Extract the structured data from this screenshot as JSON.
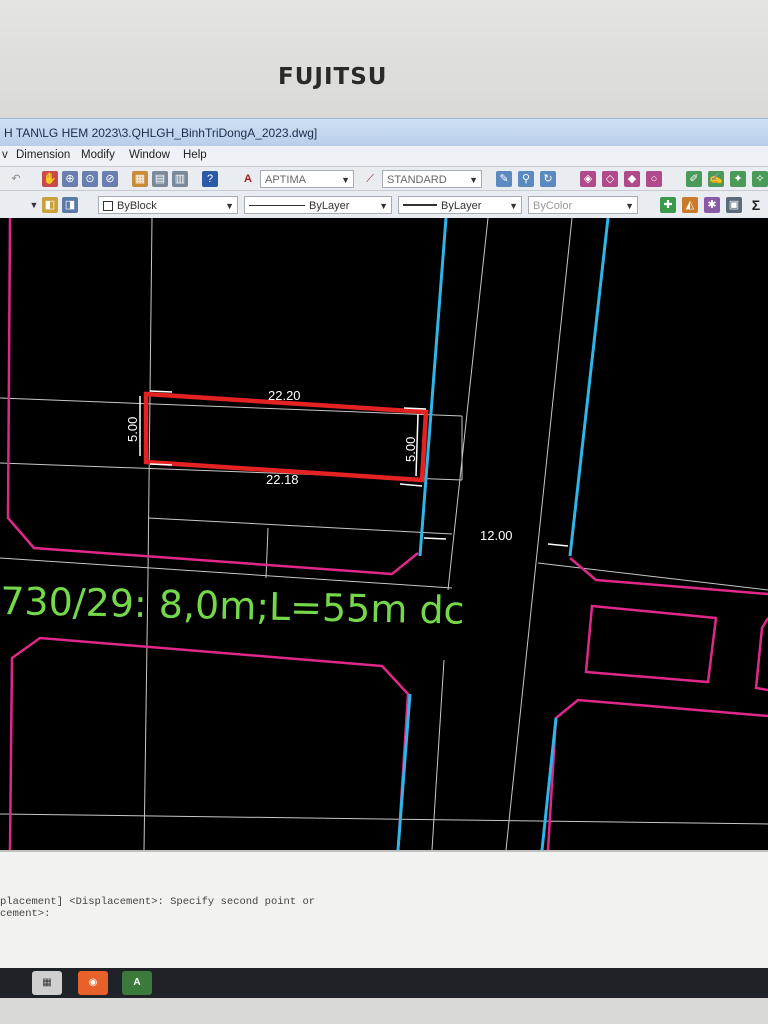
{
  "monitor": {
    "brand": "FUJITSU"
  },
  "window": {
    "title": "H TAN\\LG HEM 2023\\3.QHLGH_BinhTriDongA_2023.dwg]"
  },
  "menu": {
    "partial": "v",
    "dimension": "Dimension",
    "modify": "Modify",
    "window": "Window",
    "help": "Help"
  },
  "toolbar": {
    "text_style": "APTIMA",
    "dim_style": "STANDARD",
    "color": "ByBlock",
    "linetype": "ByLayer",
    "lineweight": "ByLayer",
    "plot_style": "ByColor",
    "sigma_label": "Σ"
  },
  "drawing": {
    "dim_top": "22.20",
    "dim_bottom": "22.18",
    "dim_left": "5.00",
    "dim_right": "5.00",
    "road_width": "12.00",
    "annotation": "730/29: 8,0m;L=55m dc",
    "colors": {
      "lot_outline": "#e52222",
      "road_edge": "#2fb6e8",
      "boundary": "#e0288a",
      "annotation": "#74d84a",
      "grid_line": "#c8c8c8"
    }
  },
  "command": {
    "line1": "placement] <Displacement>: Specify second point or",
    "line2": "cement>:"
  },
  "taskbar": {
    "icons": [
      "file-manager-icon",
      "firefox-icon",
      "autocad-icon"
    ]
  }
}
